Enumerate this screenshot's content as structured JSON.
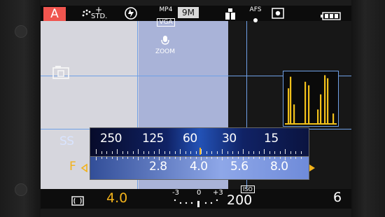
{
  "top": {
    "mode": "A",
    "photo_style": "STD.",
    "photo_style_plus": "+",
    "flash_icon": "flash-off-icon",
    "rec_format": "MP4",
    "rec_quality": "VGA",
    "picture_size": "9M",
    "focus_mode": "AFS",
    "metering_icon": "metering-multi-icon",
    "battery_icon": "battery-icon"
  },
  "main": {
    "zoom_label": "ZOOM",
    "mic_icon": "microphone-icon"
  },
  "exposure": {
    "ss_label": "SS",
    "ss_values": [
      "250",
      "125",
      "60",
      "30",
      "15"
    ],
    "f_label": "F",
    "f_values": [
      "2.8",
      "4.0",
      "5.6",
      "8.0"
    ]
  },
  "bottom": {
    "aperture_value": "4.0",
    "ev_left": "-3",
    "ev_mid": "0",
    "ev_right": "+3",
    "iso_label": "ISO",
    "iso_value": "200",
    "shots_remaining": "6"
  },
  "colors": {
    "mode_bg": "#f0554f",
    "aperture_value": "#f2b21b",
    "f_arrow": "#f2b21b",
    "grid": "#6fa0e6"
  },
  "histogram": {
    "bars": [
      0.72,
      0.95,
      0.4,
      0.85,
      0.78,
      0.3,
      0.6,
      0.98,
      0.92,
      0.22
    ]
  }
}
